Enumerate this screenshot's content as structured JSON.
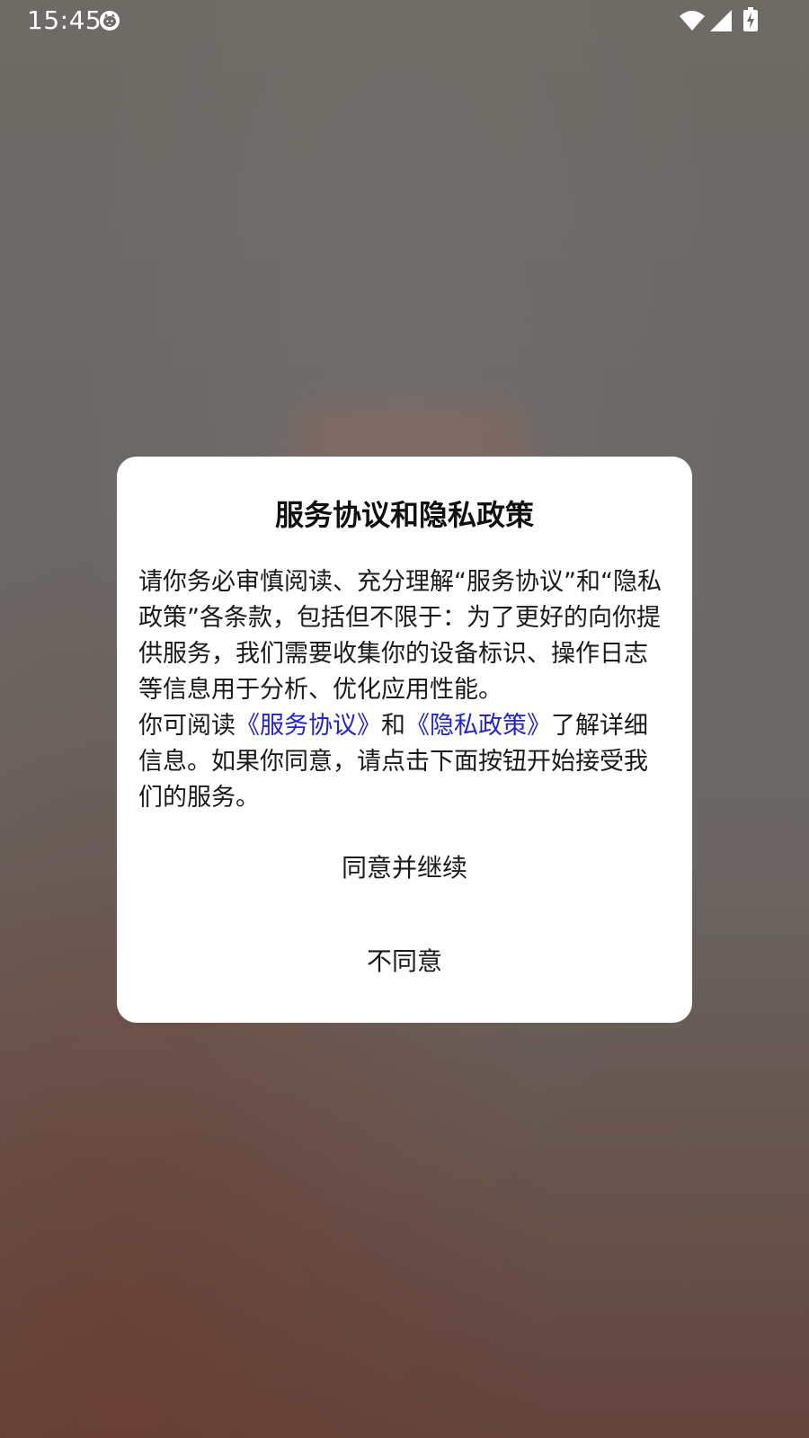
{
  "status_bar": {
    "time": "15:45",
    "icons": [
      "cat-notification-icon",
      "wifi-icon",
      "cellular-signal-icon",
      "battery-charging-icon"
    ]
  },
  "dialog": {
    "title": "服务协议和隐私政策",
    "paragraph1": "请你务必审慎阅读、充分理解“服务协议”和“隐私政策”各条款，包括但不限于：为了更好的向你提供服务，我们需要收集你的设备标识、操作日志等信息用于分析、优化应用性能。",
    "paragraph2_prefix": "你可阅读",
    "service_agreement_link": "《服务协议》",
    "paragraph2_and": "和",
    "privacy_policy_link": "《隐私政策》",
    "paragraph2_suffix": "了解详细信息。如果你同意，请点击下面按钮开始接受我们的服务。",
    "agree_button": "同意并继续",
    "disagree_button": "不同意"
  },
  "colors": {
    "link": "#2424c8",
    "dialog_background": "#ffffff",
    "text": "#1a1a1a"
  }
}
